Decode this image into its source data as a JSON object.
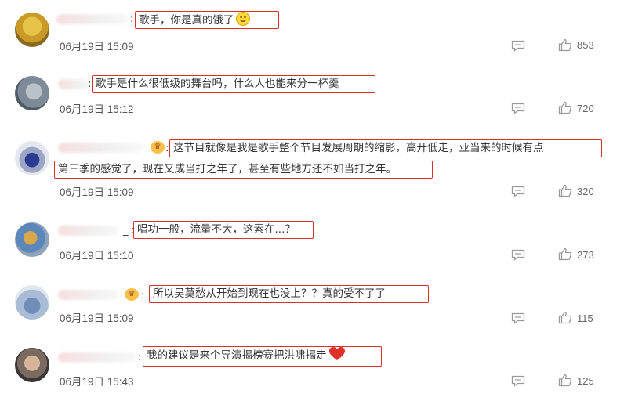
{
  "comments": [
    {
      "text": "歌手，你是真的饿了",
      "emoji": "smile-emoji",
      "time": "06月19日 15:09",
      "likes": "853",
      "has_badge": false
    },
    {
      "text": "歌手是什么很低级的舞台吗，什么人也能来分一杯羹",
      "time": "06月19日 15:12",
      "likes": "720",
      "has_badge": false
    },
    {
      "text_line1": "这节目就像是我是歌手整个节目发展周期的缩影，高开低走，亚当来的时候有点",
      "text_line2": "第三季的感觉了，现在又成当打之年了，甚至有些地方还不如当打之年。",
      "time": "06月19日 15:09",
      "likes": "320",
      "has_badge": true
    },
    {
      "text": "唱功一般，流量不大，这素在...？",
      "time": "06月19日 15:10",
      "likes": "273",
      "has_badge": false
    },
    {
      "text": "所以吴莫愁从开始到现在也没上？？真的受不了了",
      "time": "06月19日 15:09",
      "likes": "115",
      "has_badge": true
    },
    {
      "text": "我的建议是来个导演揭榜赛把洪啸揭走",
      "emoji": "heart-emoji",
      "time": "06月19日 15:43",
      "likes": "125",
      "has_badge": false
    }
  ],
  "icons": {
    "reply": "comment-icon",
    "like": "thumbs-up-icon",
    "badge": "vip-crown-icon"
  },
  "colors": {
    "highlight_border": "#d9302c",
    "text": "#333333",
    "meta": "#555555"
  }
}
